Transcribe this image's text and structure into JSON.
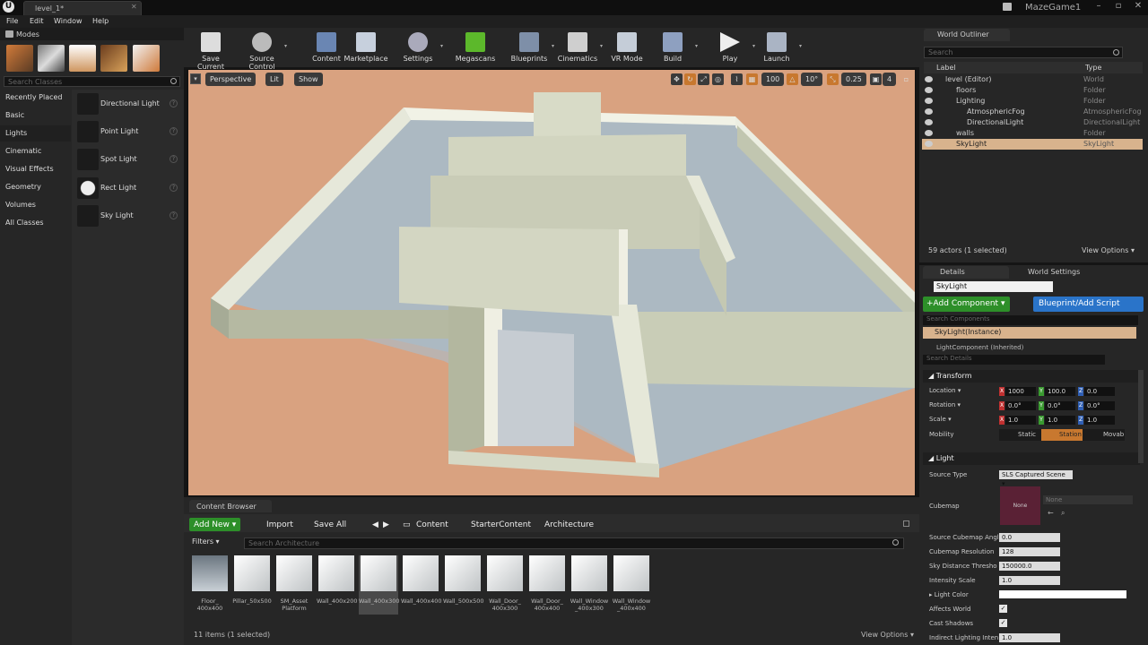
{
  "window": {
    "tab_title": "level_1*",
    "project": "MazeGame1"
  },
  "menu": [
    "File",
    "Edit",
    "Window",
    "Help"
  ],
  "modes": {
    "title": "Modes",
    "search_placeholder": "Search Classes",
    "categories": [
      "Recently Placed",
      "Basic",
      "Lights",
      "Cinematic",
      "Visual Effects",
      "Geometry",
      "Volumes",
      "All Classes"
    ],
    "selected_category": "Lights",
    "items": [
      "Directional Light",
      "Point Light",
      "Spot Light",
      "Rect Light",
      "Sky Light"
    ],
    "help_glyph": "?"
  },
  "toolbar": [
    "Save Current",
    "Source Control",
    "Content",
    "Marketplace",
    "Settings",
    "Megascans",
    "Blueprints",
    "Cinematics",
    "VR Mode",
    "Build",
    "Play",
    "Launch"
  ],
  "viewport": {
    "perspective": "Perspective",
    "lit": "Lit",
    "show": "Show",
    "grid": "100",
    "angle": "10°",
    "scale": "0.25",
    "cam": "4"
  },
  "content_browser": {
    "tab": "Content Browser",
    "add_new": "Add New",
    "import": "Import",
    "save_all": "Save All",
    "path": [
      "Content",
      "StarterContent",
      "Architecture"
    ],
    "filters": "Filters",
    "search_placeholder": "Search Architecture",
    "assets": [
      "Floor_\n400x400",
      "Pillar_50x500",
      "SM_Asset\nPlatform",
      "Wall_400x200",
      "Wall_400x300",
      "Wall_400x400",
      "Wall_500x500",
      "Wall_Door_\n400x300",
      "Wall_Door_\n400x400",
      "Wall_Window\n_400x300",
      "Wall_Window\n_400x400"
    ],
    "selected_asset": 4,
    "status": "11 items (1 selected)",
    "view_options": "View Options"
  },
  "outliner": {
    "tab": "World Outliner",
    "search_placeholder": "Search",
    "col_label": "Label",
    "col_type": "Type",
    "rows": [
      {
        "label": "level (Editor)",
        "type": "World",
        "indent": 0
      },
      {
        "label": "floors",
        "type": "Folder",
        "indent": 1
      },
      {
        "label": "Lighting",
        "type": "Folder",
        "indent": 1
      },
      {
        "label": "AtmosphericFog",
        "type": "AtmosphericFog",
        "indent": 2
      },
      {
        "label": "DirectionalLight",
        "type": "DirectionalLight",
        "indent": 2
      },
      {
        "label": "walls",
        "type": "Folder",
        "indent": 1
      },
      {
        "label": "SkyLight",
        "type": "SkyLight",
        "indent": 1
      }
    ],
    "selected_row": 6,
    "status": "59 actors (1 selected)",
    "view_options": "View Options"
  },
  "details": {
    "tab": "Details",
    "tab2": "World Settings",
    "name": "SkyLight",
    "add_component": "Add Component",
    "blueprint": "Blueprint/Add Script",
    "search_components": "Search Components",
    "instance": "SkyLight(Instance)",
    "light_component": "LightComponent (Inherited)",
    "search_details": "Search Details",
    "transform": "Transform",
    "location_label": "Location",
    "location": [
      "1000",
      "100.0",
      "0.0"
    ],
    "rotation_label": "Rotation",
    "rotation": [
      "0.0°",
      "0.0°",
      "0.0°"
    ],
    "scale_label": "Scale",
    "scale": [
      "1.0",
      "1.0",
      "1.0"
    ],
    "mobility_label": "Mobility",
    "mobility": [
      "Static",
      "Station",
      "Movab"
    ],
    "light": "Light",
    "source_type_label": "Source Type",
    "source_type": "SLS Captured Scene",
    "cubemap_label": "Cubemap",
    "cubemap_value": "None",
    "cubemap_select": "None",
    "props": [
      {
        "label": "Source Cubemap Angl",
        "value": "0.0"
      },
      {
        "label": "Cubemap Resolution",
        "value": "128"
      },
      {
        "label": "Sky Distance Thresho",
        "value": "150000.0"
      },
      {
        "label": "Intensity Scale",
        "value": "1.0"
      }
    ],
    "light_color_label": "Light Color",
    "affects_world_label": "Affects World",
    "cast_shadows_label": "Cast Shadows",
    "indirect_label": "Indirect Lighting Inten",
    "indirect_value": "1.0"
  },
  "colors": {
    "green": "#2d8f29",
    "blue": "#2a74c9",
    "selection": "#d8b38d",
    "floor": "#d9a280"
  }
}
